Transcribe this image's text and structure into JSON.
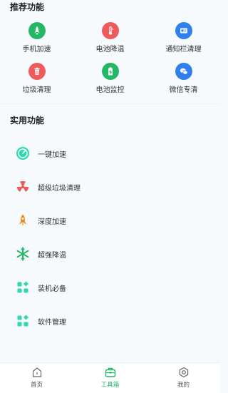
{
  "recommended": {
    "title": "推荐功能",
    "items": [
      {
        "label": "手机加速",
        "icon": "rocket-icon",
        "color": "#23b866"
      },
      {
        "label": "电池降温",
        "icon": "thermometer-icon",
        "color": "#ef5a5a"
      },
      {
        "label": "通知栏清理",
        "icon": "notification-card-icon",
        "color": "#2f80ed"
      },
      {
        "label": "垃圾清理",
        "icon": "trash-icon",
        "color": "#ef5a5a"
      },
      {
        "label": "电池监控",
        "icon": "battery-icon",
        "color": "#23b866"
      },
      {
        "label": "微信专清",
        "icon": "wechat-icon",
        "color": "#2f80ed"
      }
    ]
  },
  "practical": {
    "title": "实用功能",
    "items": [
      {
        "label": "一键加速",
        "icon": "speedometer-icon",
        "color": "#2fd8b0"
      },
      {
        "label": "超级垃圾清理",
        "icon": "radiation-icon",
        "color": "#ef5a5a"
      },
      {
        "label": "深度加速",
        "icon": "rocket-icon",
        "color": "#f28c28"
      },
      {
        "label": "超强降温",
        "icon": "snowflake-icon",
        "color": "#23b866"
      },
      {
        "label": "装机必备",
        "icon": "apps-grid-icon",
        "color": "#2fd8b0"
      },
      {
        "label": "软件管理",
        "icon": "apps-grid-icon",
        "color": "#2fd8b0"
      }
    ]
  },
  "tabbar": {
    "tabs": [
      {
        "label": "首页",
        "icon": "home-icon",
        "active": false
      },
      {
        "label": "工具箱",
        "icon": "toolbox-icon",
        "active": true
      },
      {
        "label": "我的",
        "icon": "profile-icon",
        "active": false
      }
    ],
    "active_color": "#27b467"
  }
}
